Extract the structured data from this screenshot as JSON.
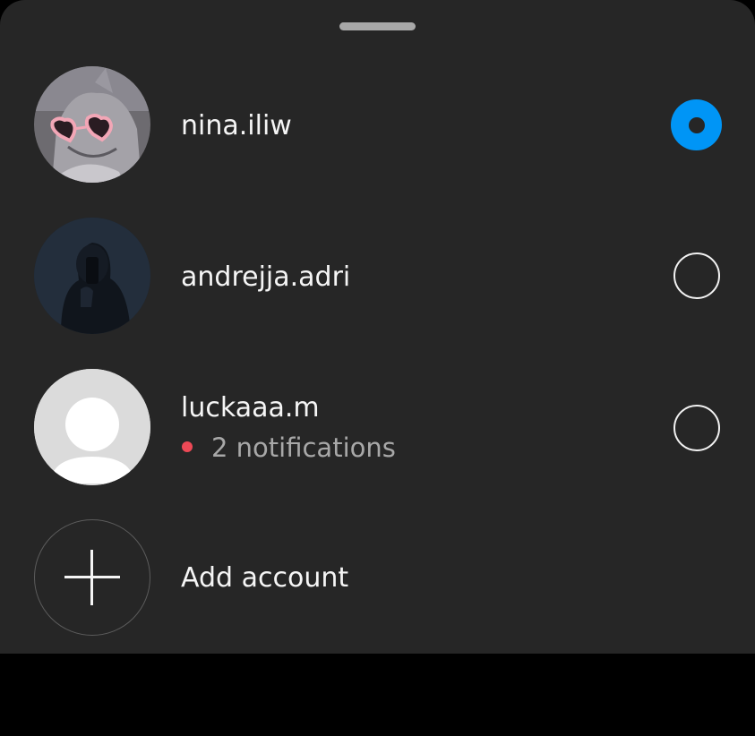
{
  "accounts": [
    {
      "username": "nina.iliw",
      "selected": true,
      "avatar": "cat-with-heart-sunglasses-photo"
    },
    {
      "username": "andrejja.adri",
      "selected": false,
      "avatar": "dark-mirror-selfie-photo"
    },
    {
      "username": "luckaaa.m",
      "selected": false,
      "avatar": "default-avatar",
      "notifications_text": "2 notifications"
    }
  ],
  "add_account": {
    "label": "Add account",
    "icon": "plus-icon"
  },
  "colors": {
    "sheet_bg": "#262626",
    "accent": "#0095f6",
    "notification_dot": "#ed4956",
    "text_primary": "#f5f5f5",
    "text_secondary": "#a8a8a8"
  }
}
